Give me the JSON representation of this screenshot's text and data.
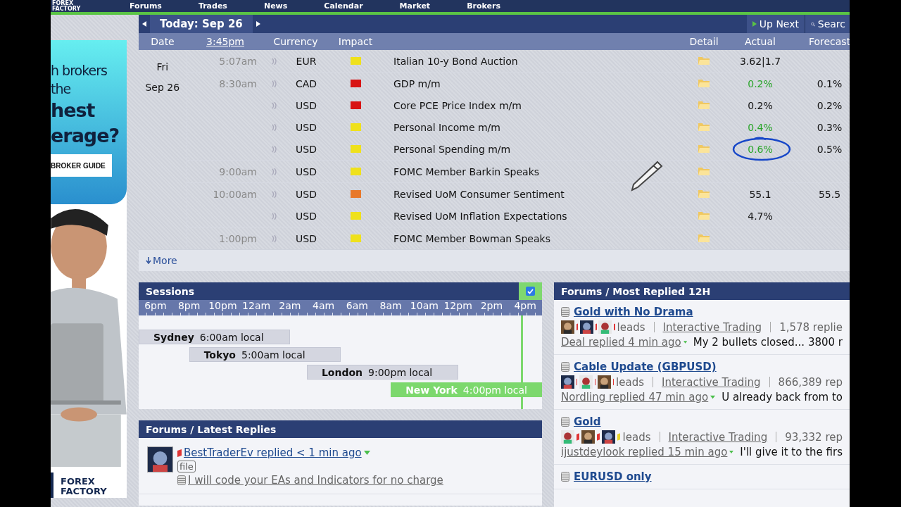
{
  "nav": {
    "logo": [
      "FOREX",
      "FACTORY"
    ],
    "items": [
      "Forums",
      "Trades",
      "News",
      "Calendar",
      "Market",
      "Brokers"
    ]
  },
  "ad": {
    "kind": "picture",
    "lines": [
      {
        "text": "h brokers",
        "bold": false
      },
      {
        "text": "the",
        "bold": false
      },
      {
        "text": "hest",
        "bold": true
      },
      {
        "text": "erage?",
        "bold": true
      }
    ],
    "button": "BROKER GUIDE",
    "logo": [
      "FOREX",
      "FACTORY"
    ]
  },
  "calendar": {
    "title": "Today: Sep 26",
    "up_next": "Up Next",
    "search": "Searc",
    "headers": {
      "date": "Date",
      "clock": "3:45pm",
      "currency": "Currency",
      "impact": "Impact",
      "detail": "Detail",
      "actual": "Actual",
      "forecast": "Forecast"
    },
    "day": "Fri",
    "date": "Sep 26",
    "events": [
      {
        "time": "5:07am",
        "currency": "EUR",
        "color": "#efe11c",
        "event": "Italian 10-y Bond Auction",
        "actual": "3.62|1.7",
        "actual_better": false,
        "circled": false
      },
      {
        "time": "8:30am",
        "currency": "CAD",
        "color": "#d81414",
        "event": "GDP m/m",
        "actual": "0.2%",
        "actual_better": true,
        "circled": false,
        "forecast": "0.1%"
      },
      {
        "currency": "USD",
        "color": "#d81414",
        "event": "Core PCE Price Index m/m",
        "actual": "0.2%",
        "actual_better": false,
        "circled": false,
        "forecast": "0.2%"
      },
      {
        "currency": "USD",
        "color": "#efe11c",
        "event": "Personal Income m/m",
        "actual": "0.4%",
        "actual_better": true,
        "circled": false,
        "forecast": "0.3%"
      },
      {
        "currency": "USD",
        "color": "#efe11c",
        "event": "Personal Spending m/m",
        "actual": "0.6%",
        "actual_better": true,
        "circled": true,
        "forecast": "0.5%"
      },
      {
        "time": "9:00am",
        "currency": "USD",
        "color": "#efe11c",
        "event": "FOMC Member Barkin Speaks"
      },
      {
        "time": "10:00am",
        "currency": "USD",
        "color": "#e8782a",
        "event": "Revised UoM Consumer Sentiment",
        "actual": "55.1",
        "actual_better": false,
        "circled": false,
        "forecast": "55.5"
      },
      {
        "currency": "USD",
        "color": "#efe11c",
        "event": "Revised UoM Inflation Expectations",
        "actual": "4.7%",
        "actual_better": false,
        "circled": false
      },
      {
        "time": "1:00pm",
        "currency": "USD",
        "color": "#efe11c",
        "event": "FOMC Member Bowman Speaks"
      }
    ],
    "more": "More"
  },
  "sessions": {
    "title": "Sessions",
    "checked": true,
    "hours": [
      "6pm",
      "8pm",
      "10pm",
      "12am",
      "2am",
      "4am",
      "6am",
      "8am",
      "10am",
      "12pm",
      "2pm",
      "4pm"
    ],
    "markets": [
      {
        "name": "Sydney",
        "local": "6:00am local",
        "active": false
      },
      {
        "name": "Tokyo",
        "local": "5:00am local",
        "active": false
      },
      {
        "name": "London",
        "local": "9:00pm local",
        "active": false
      },
      {
        "name": "New York",
        "local": "4:00pm local",
        "active": true
      }
    ]
  },
  "latest_replies": {
    "title": "Forums / Latest Replies",
    "items": [
      {
        "color": "#e03535",
        "reply": "BestTraderEv replied < 1 min ago",
        "tag": "file",
        "thread": "I will code your EAs and Indicators for no charge"
      }
    ]
  },
  "most_replied": {
    "title": "Forums / Most Replied 12H",
    "threads": [
      {
        "title": "Gold with No Drama",
        "leaders": [
          {
            "color": "#e03535"
          },
          {
            "color": "#e03535"
          },
          {
            "color": "#e03535"
          }
        ],
        "leads": "leads",
        "forum": "Interactive Trading",
        "replies": "1,578 replie",
        "last_reply": "Deal replied 4 min ago",
        "excerpt": "My 2 bullets closed... 3800 r"
      },
      {
        "title": "Cable Update (GBPUSD)",
        "leaders": [
          {
            "color": "#e03535"
          },
          {
            "color": "#e03535"
          },
          {
            "color": "#e03535"
          }
        ],
        "leads": "leads",
        "forum": "Interactive Trading",
        "replies": "866,389 rep",
        "last_reply": "Nordling replied 47 min ago",
        "excerpt": "U already back from to"
      },
      {
        "title": "Gold",
        "leaders": [
          {
            "color": "#e03535"
          },
          {
            "color": "#e03535"
          },
          {
            "color": "#e8d42a"
          }
        ],
        "leads": "leads",
        "forum": "Interactive Trading",
        "replies": "93,332 rep",
        "last_reply": "ijustdeylook replied 15 min ago",
        "excerpt": "I'll give it to the firs"
      },
      {
        "title": "EURUSD only"
      }
    ]
  }
}
